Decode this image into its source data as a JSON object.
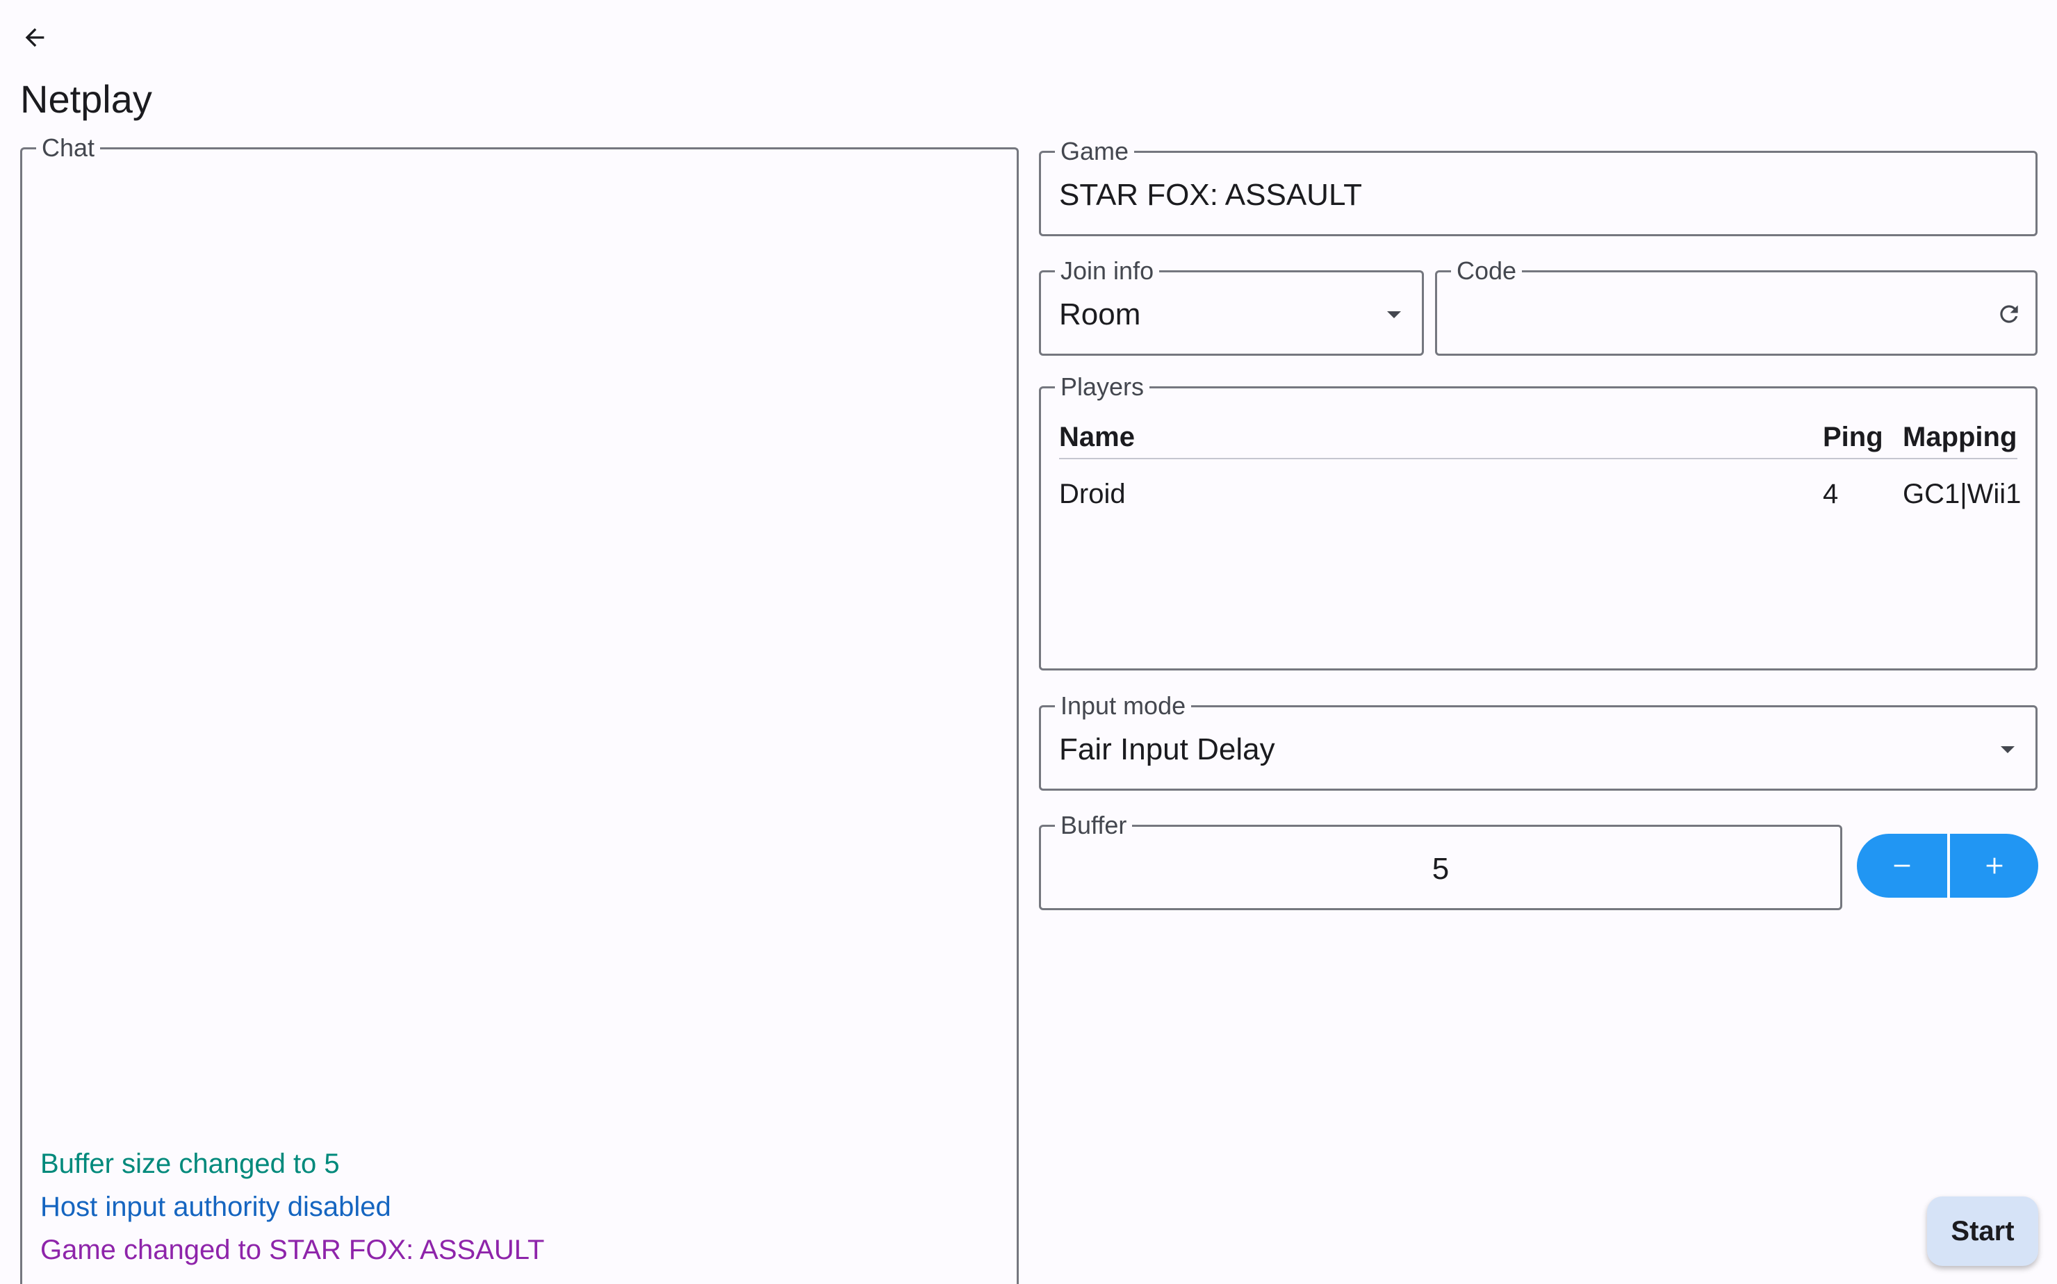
{
  "header": {
    "title": "Netplay",
    "back_icon": "arrow-left-icon"
  },
  "chat": {
    "label": "Chat",
    "messages": [
      {
        "text": "Buffer size changed to 5",
        "color": "#00897b"
      },
      {
        "text": "Host input authority disabled",
        "color": "#1565c0"
      },
      {
        "text": "Game changed to STAR FOX: ASSAULT",
        "color": "#8e24aa"
      }
    ]
  },
  "game": {
    "label": "Game",
    "value": "STAR FOX: ASSAULT"
  },
  "join_info": {
    "label": "Join info",
    "value": "Room"
  },
  "code": {
    "label": "Code",
    "value": "",
    "refresh_icon": "refresh-icon"
  },
  "players": {
    "label": "Players",
    "columns": [
      "Name",
      "Ping",
      "Mapping"
    ],
    "rows": [
      [
        "Droid",
        "4",
        "GC1|Wii1"
      ]
    ]
  },
  "input_mode": {
    "label": "Input mode",
    "value": "Fair Input Delay"
  },
  "buffer": {
    "label": "Buffer",
    "value": "5",
    "decrement_icon": "minus-icon",
    "increment_icon": "plus-icon"
  },
  "actions": {
    "start_label": "Start"
  },
  "colors": {
    "accent": "#2196f3",
    "start_button_bg": "#d6e3f7",
    "outline": "#75777f"
  }
}
